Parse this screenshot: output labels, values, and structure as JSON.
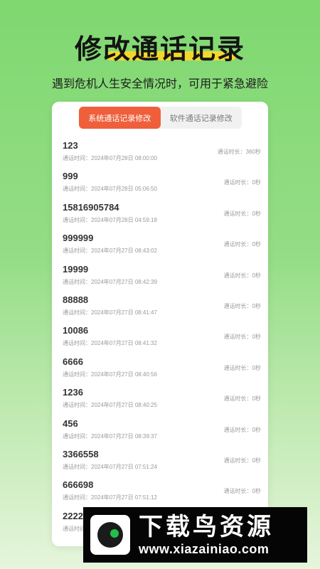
{
  "header": {
    "title": "修改通话记录",
    "subtitle": "遇到危机人生安全情况时，可用于紧急避险"
  },
  "tabs": [
    {
      "label": "系统通话记录修改",
      "active": true
    },
    {
      "label": "软件通话记录修改",
      "active": false
    }
  ],
  "records": [
    {
      "number": "123",
      "time": "通话时间：2024年07月28日 08:00:00",
      "duration": "通话时长：360秒"
    },
    {
      "number": "999",
      "time": "通话时间：2024年07月28日 05:06:50",
      "duration": "通话时长：0秒"
    },
    {
      "number": "15816905784",
      "time": "通话时间：2024年07月28日 04:59:18",
      "duration": "通话时长：0秒"
    },
    {
      "number": "999999",
      "time": "通话时间：2024年07月27日 08:43:02",
      "duration": "通话时长：0秒"
    },
    {
      "number": "19999",
      "time": "通话时间：2024年07月27日 08:42:39",
      "duration": "通话时长：0秒"
    },
    {
      "number": "88888",
      "time": "通话时间：2024年07月27日 08:41:47",
      "duration": "通话时长：0秒"
    },
    {
      "number": "10086",
      "time": "通话时间：2024年07月27日 08:41:32",
      "duration": "通话时长：0秒"
    },
    {
      "number": "6666",
      "time": "通话时间：2024年07月27日 08:40:56",
      "duration": "通话时长：0秒"
    },
    {
      "number": "1236",
      "time": "通话时间：2024年07月27日 08:40:25",
      "duration": "通话时长：0秒"
    },
    {
      "number": "456",
      "time": "通话时间：2024年07月27日 08:39:37",
      "duration": "通话时长：0秒"
    },
    {
      "number": "3366558",
      "time": "通话时间：2024年07月27日 07:51:24",
      "duration": "通话时长：0秒"
    },
    {
      "number": "666698",
      "time": "通话时间：2024年07月27日 07:51:12",
      "duration": "通话时长：0秒"
    },
    {
      "number": "2222",
      "time": "通话时间：",
      "duration": ""
    }
  ],
  "watermark": {
    "title": "下载鸟资源",
    "url": "www.xiazainiao.com"
  },
  "colors": {
    "accent": "#ef5f3c",
    "highlight": "#f4d72e",
    "background_top": "#7fd870"
  }
}
